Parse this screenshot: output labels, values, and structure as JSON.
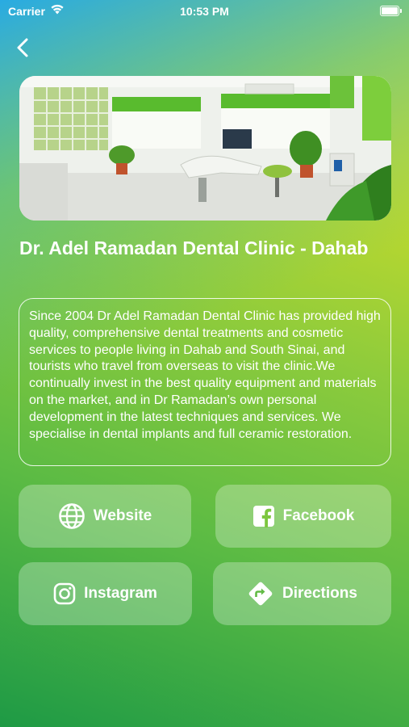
{
  "status_bar": {
    "carrier": "Carrier",
    "time": "10:53 PM"
  },
  "nav": {
    "back_icon": "chevron-left-icon"
  },
  "clinic": {
    "name": "Dr. Adel Ramadan Dental Clinic - Dahab",
    "description": "Since 2004 Dr Adel Ramadan Dental Clinic has provided high quality, comprehensive dental treatments and cosmetic services to people living in Dahab and South Sinai, and tourists who travel from overseas to visit the clinic.We continually invest in the best quality equipment and materials on the market, and in Dr Ramadan’s own personal development in the latest techniques and services. We specialise in dental implants and full ceramic restoration."
  },
  "actions": [
    {
      "label": "Website",
      "icon": "globe-icon"
    },
    {
      "label": "Facebook",
      "icon": "facebook-icon"
    },
    {
      "label": "Instagram",
      "icon": "instagram-icon"
    },
    {
      "label": "Directions",
      "icon": "directions-icon"
    }
  ],
  "colors": {
    "gradient_top_left": "#20a8ec",
    "gradient_top_right": "#e9e51f",
    "gradient_bottom": "#1e9a45",
    "text": "#ffffff"
  }
}
